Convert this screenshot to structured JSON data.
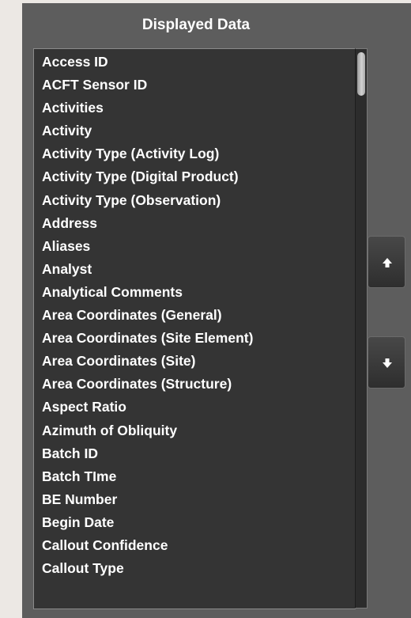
{
  "panel": {
    "title": "Displayed Data"
  },
  "list": {
    "items": [
      "Access ID",
      "ACFT Sensor ID",
      "Activities",
      "Activity",
      "Activity Type (Activity Log)",
      "Activity Type (Digital Product)",
      "Activity Type (Observation)",
      "Address",
      "Aliases",
      "Analyst",
      "Analytical Comments",
      "Area Coordinates (General)",
      "Area Coordinates (Site Element)",
      "Area Coordinates (Site)",
      "Area Coordinates (Structure)",
      "Aspect Ratio",
      "Azimuth of Obliquity",
      "Batch ID",
      "Batch TIme",
      "BE Number",
      "Begin Date",
      "Callout Confidence",
      "Callout Type"
    ]
  },
  "buttons": {
    "move_up_icon": "arrow-up-icon",
    "move_down_icon": "arrow-down-icon"
  },
  "colors": {
    "panel_bg": "#5d5d5d",
    "list_bg": "#343434",
    "text": "#ffffff",
    "page_bg": "#ece8e4"
  }
}
